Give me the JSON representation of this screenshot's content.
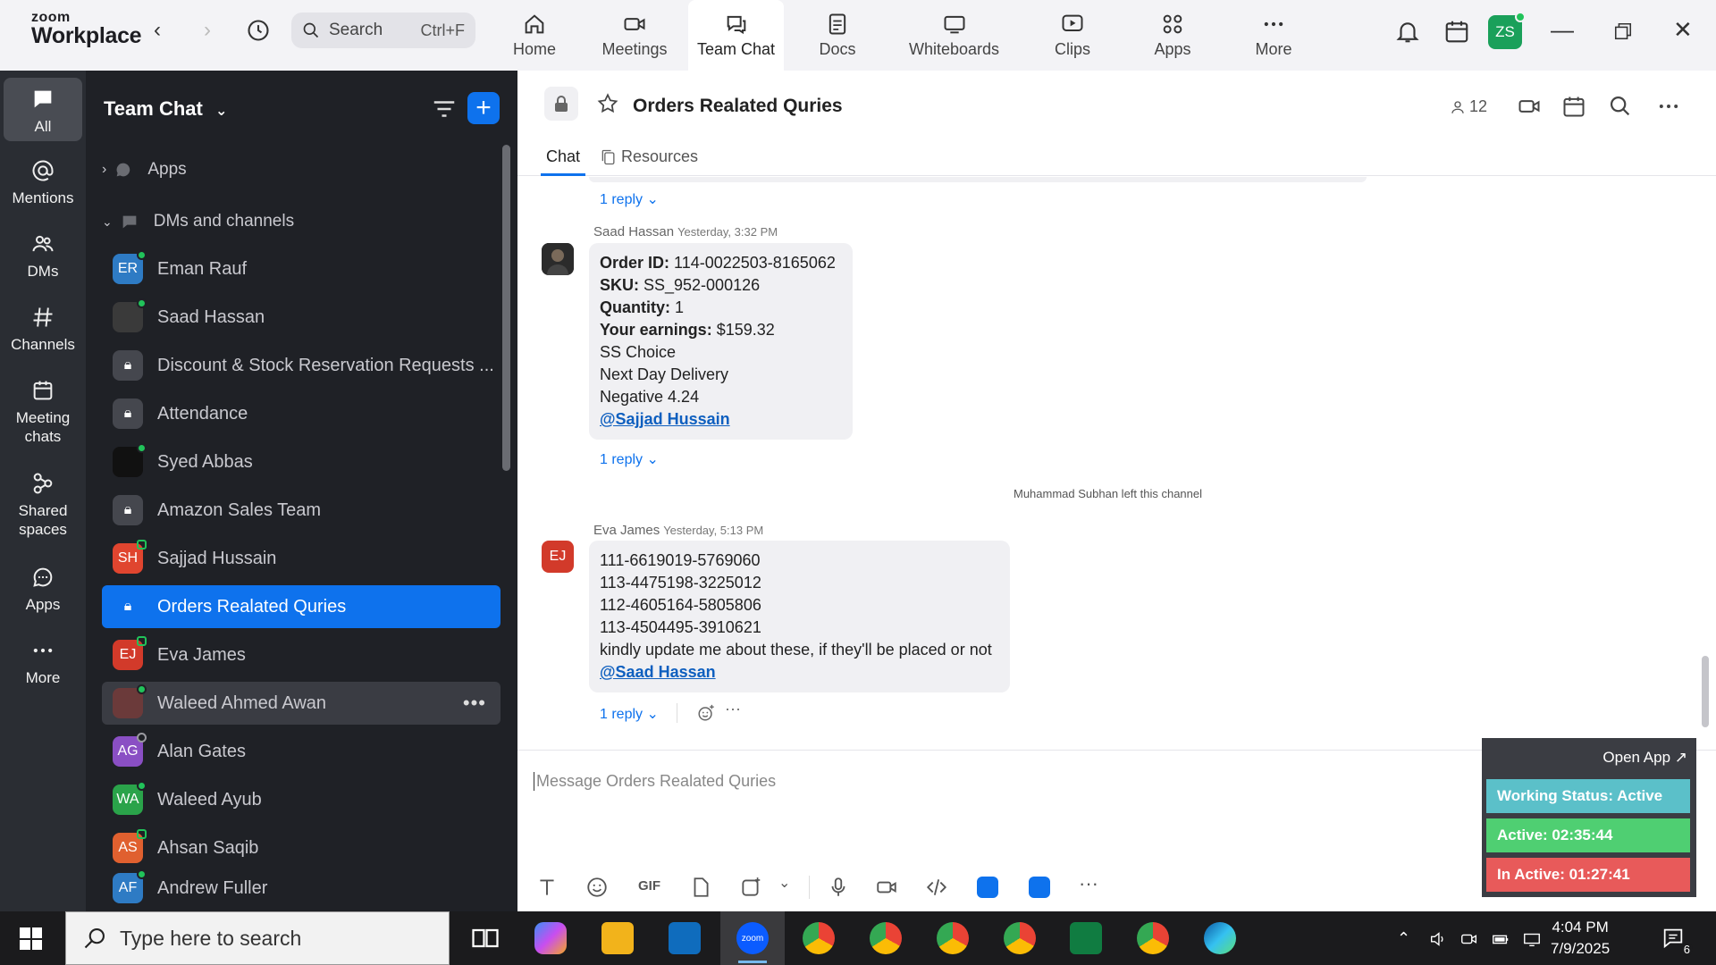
{
  "app": {
    "logo_line1": "zoom",
    "logo_line2": "Workplace",
    "search_label": "Search",
    "search_shortcut": "Ctrl+F",
    "user_initials": "ZS"
  },
  "nav_tabs": [
    {
      "label": "Home",
      "icon": "home-icon"
    },
    {
      "label": "Meetings",
      "icon": "video-camera-icon"
    },
    {
      "label": "Team Chat",
      "icon": "chat-bubble-icon"
    },
    {
      "label": "Docs",
      "icon": "document-icon"
    },
    {
      "label": "Whiteboards",
      "icon": "whiteboard-icon"
    },
    {
      "label": "Clips",
      "icon": "clips-icon"
    },
    {
      "label": "Apps",
      "icon": "apps-icon"
    },
    {
      "label": "More",
      "icon": "more-dots-icon"
    }
  ],
  "rail": [
    {
      "label": "All"
    },
    {
      "label": "Mentions"
    },
    {
      "label": "DMs"
    },
    {
      "label": "Channels"
    },
    {
      "label": "Meeting chats"
    },
    {
      "label": "Shared spaces"
    },
    {
      "label": "Apps"
    },
    {
      "label": "More"
    }
  ],
  "sidebar": {
    "title": "Team Chat",
    "section_apps": "Apps",
    "section_dms": "DMs and channels",
    "items": [
      {
        "label": "Eman Rauf",
        "initials": "ER",
        "color": "#2e7bc4"
      },
      {
        "label": "Saad Hassan",
        "initials": "",
        "color": "#3a3a3a"
      },
      {
        "label": "Discount & Stock Reservation Requests ...",
        "initials": "",
        "color": "#45474e"
      },
      {
        "label": "Attendance",
        "initials": "",
        "color": "#45474e"
      },
      {
        "label": "Syed Abbas",
        "initials": "",
        "color": "#111111"
      },
      {
        "label": "Amazon Sales Team",
        "initials": "",
        "color": "#45474e"
      },
      {
        "label": "Sajjad Hussain",
        "initials": "SH",
        "color": "#e0452f"
      },
      {
        "label": "Orders Realated Quries",
        "initials": "",
        "color": "#0e72ed"
      },
      {
        "label": "Eva James",
        "initials": "EJ",
        "color": "#d23a2a"
      },
      {
        "label": "Waleed Ahmed Awan",
        "initials": "",
        "color": "#6b3a3a"
      },
      {
        "label": "Alan Gates",
        "initials": "AG",
        "color": "#8a4fc4"
      },
      {
        "label": "Waleed Ayub",
        "initials": "WA",
        "color": "#2aa34a"
      },
      {
        "label": "Ahsan Saqib",
        "initials": "AS",
        "color": "#e0602f"
      },
      {
        "label": "Andrew Fuller",
        "initials": "AF",
        "color": "#2e7bc4"
      }
    ]
  },
  "channel": {
    "title": "Orders Realated Quries",
    "member_count": "12",
    "tabs": [
      "Chat",
      "Resources"
    ]
  },
  "messages": {
    "reply_top": "1 reply",
    "m1": {
      "author": "Saad Hassan",
      "time": "Yesterday, 3:32 PM",
      "order_label": "Order ID:",
      "order_value": " 114-0022503-8165062",
      "sku_label": "SKU:",
      "sku_value": " SS_952-000126",
      "qty_label": "Quantity:",
      "qty_value": " 1",
      "earn_label": "Your earnings:",
      "earn_value": " $159.32",
      "line5": "SS Choice",
      "line6": "Next Day Delivery",
      "line7": "Negative 4.24",
      "mention": "@Sajjad Hussain",
      "reply": "1 reply"
    },
    "system": "Muhammad Subhan left this channel",
    "m2": {
      "author": "Eva James",
      "initials": "EJ",
      "time": "Yesterday, 5:13 PM",
      "lines": [
        "111-6619019-5769060",
        "113-4475198-3225012",
        "112-4605164-5805806",
        "113-4504495-3910621",
        "kindly update me about these, if they'll be placed or not"
      ],
      "mention": "@Saad Hassan",
      "reply": "1 reply"
    }
  },
  "composer": {
    "placeholder": "Message Orders Realated Quries",
    "gif_label": "GIF"
  },
  "widget": {
    "open_app": "Open App ↗",
    "status": "Working Status: Active",
    "active": "Active: 02:35:44",
    "inactive": "In Active: 01:27:41",
    "status_color": "#5bc0c9",
    "active_color": "#4fcf72",
    "inactive_color": "#e85a5a"
  },
  "taskbar": {
    "search_placeholder": "Type here to search",
    "time": "4:04 PM",
    "date": "7/9/2025",
    "notification_count": "6"
  }
}
